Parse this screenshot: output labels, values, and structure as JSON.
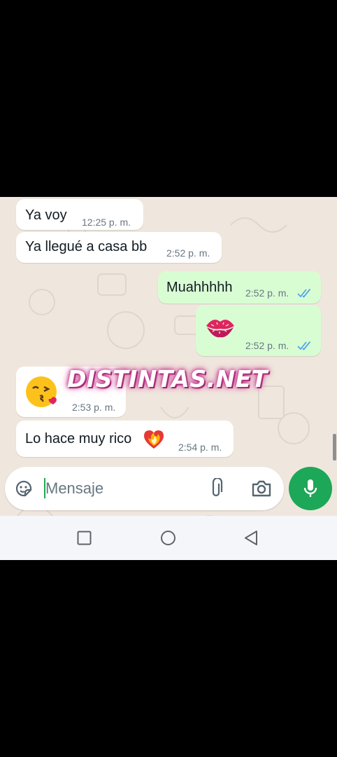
{
  "colors": {
    "incoming_bubble": "#ffffff",
    "outgoing_bubble": "#d9fdd3",
    "read_ticks": "#53a6e8",
    "mic_button": "#1da758",
    "chat_background": "#efe7dd"
  },
  "messages": [
    {
      "direction": "in",
      "text": "Ya voy",
      "time": "12:25 p. m."
    },
    {
      "direction": "in",
      "text": "Ya llegué a casa bb",
      "time": "2:52 p. m."
    },
    {
      "direction": "out",
      "text": "Muahhhhh",
      "time": "2:52 p. m.",
      "status": "read"
    },
    {
      "direction": "out",
      "emoji": "kiss-mark",
      "time": "2:52 p. m.",
      "status": "read"
    },
    {
      "direction": "in",
      "emoji": "face-blowing-a-kiss",
      "time": "2:53 p. m."
    },
    {
      "direction": "in",
      "text": "Lo hace muy rico",
      "emoji": "heart-on-fire",
      "time": "2:54 p. m."
    }
  ],
  "watermark": "DISTINTAS.NET",
  "composer": {
    "placeholder": "Mensaje",
    "icons": [
      "sticker-icon",
      "attach-icon",
      "camera-icon",
      "mic-icon"
    ]
  },
  "navbar": {
    "icons": [
      "recents-icon",
      "home-icon",
      "back-icon"
    ]
  }
}
